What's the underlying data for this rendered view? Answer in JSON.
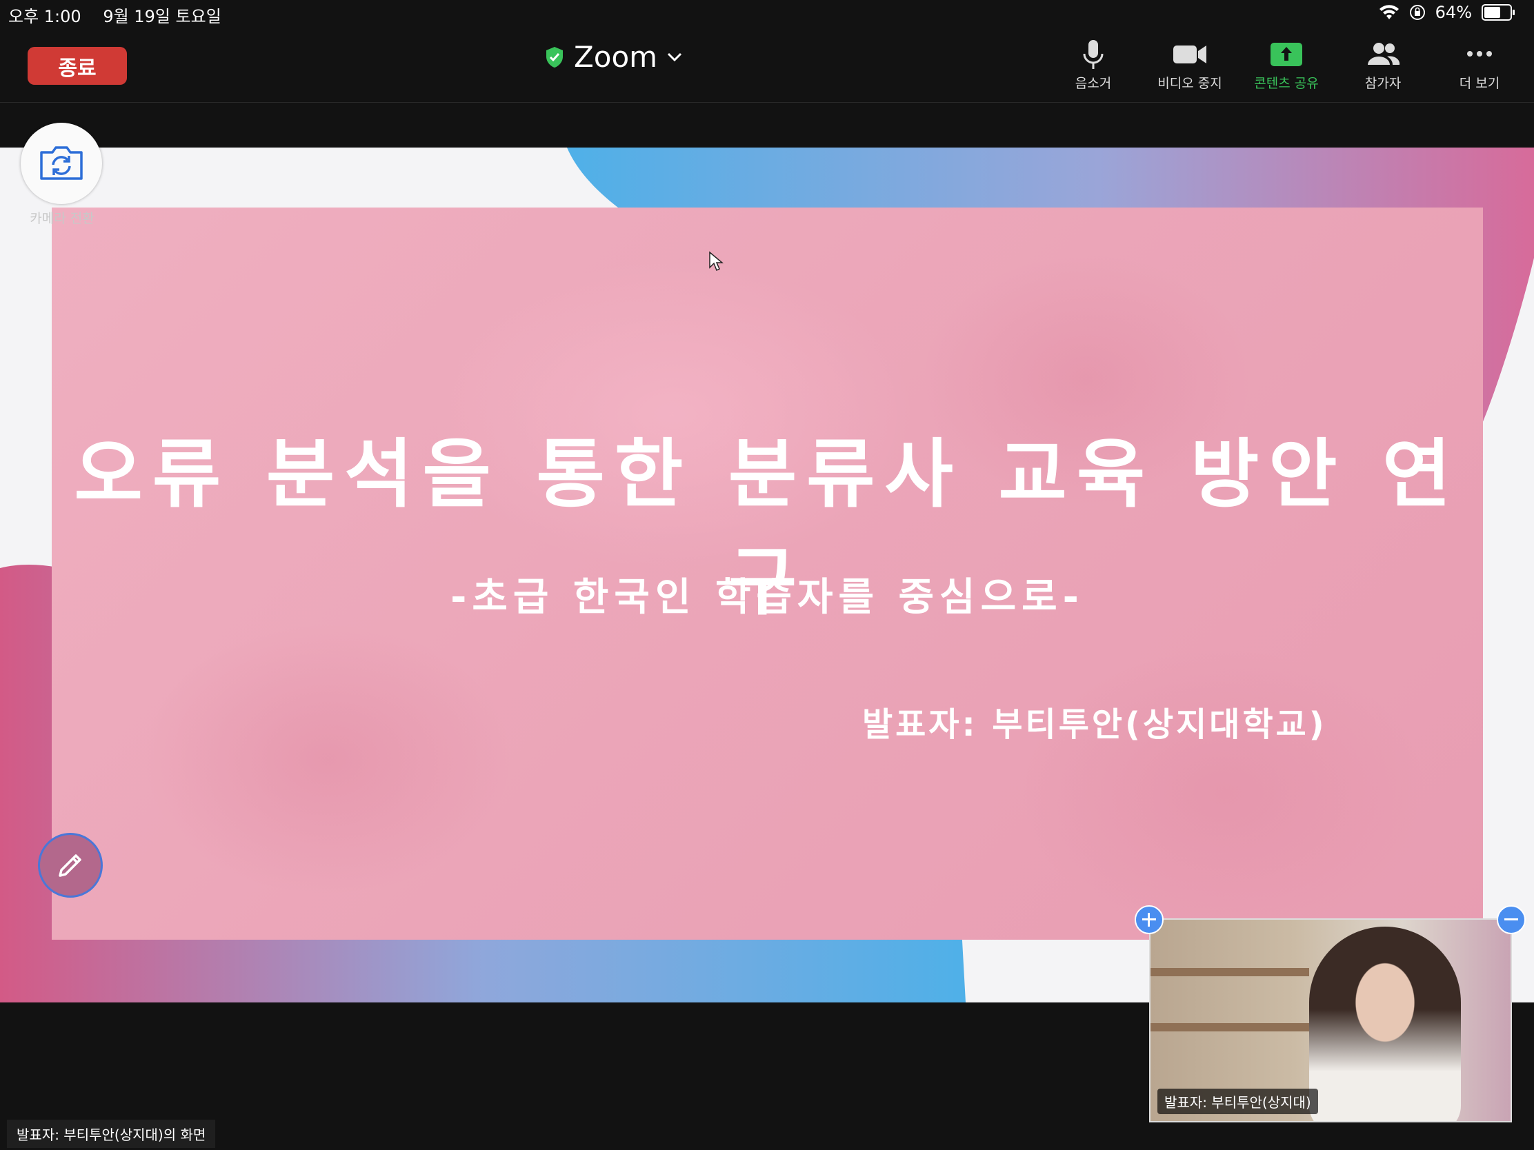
{
  "status_bar": {
    "time": "오후 1:00",
    "date": "9월 19일 토요일",
    "battery": "64%",
    "battery_level": 0.64
  },
  "toolbar": {
    "end_label": "종료",
    "app_title": "Zoom",
    "items": [
      {
        "label": "음소거",
        "icon": "microphone-icon"
      },
      {
        "label": "비디오 중지",
        "icon": "video-camera-icon"
      },
      {
        "label": "콘텐츠 공유",
        "icon": "share-screen-icon"
      },
      {
        "label": "참가자",
        "icon": "participants-icon"
      },
      {
        "label": "더 보기",
        "icon": "more-icon"
      }
    ]
  },
  "camera_switch_label": "카메라 전환",
  "slide": {
    "title": "오류 분석을 통한 분류사 교육 방안 연구",
    "subtitle": "-초급 한국인 학습자를 중심으로-",
    "presenter": "발표자: 부티투안(상지대학교)"
  },
  "video_thumbnail": {
    "label": "발표자: 부티투안(상지대)"
  },
  "screen_share_label": "발표자: 부티투안(상지대)의 화면",
  "colors": {
    "end_button": "#d03a35",
    "share_green": "#39c35a",
    "slide_pink": "#eba5b8",
    "accent_blue": "#4a8ef0"
  }
}
